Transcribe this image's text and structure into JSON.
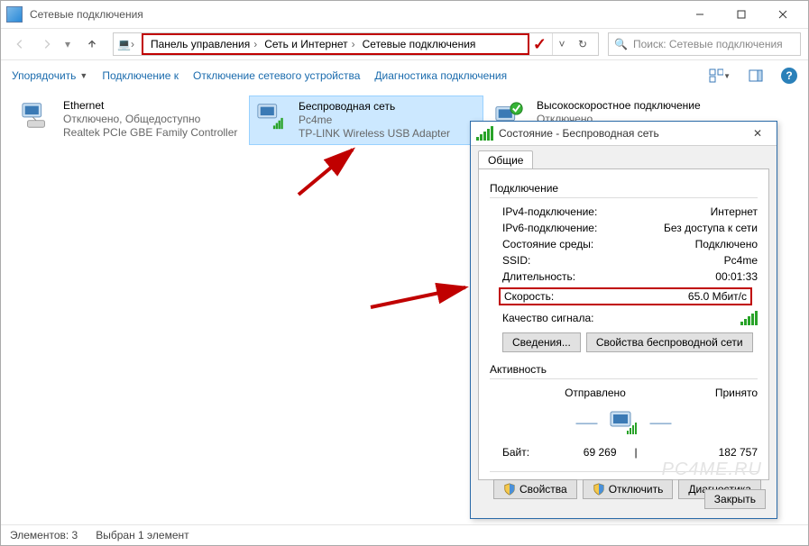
{
  "title": "Сетевые подключения",
  "breadcrumb": {
    "p1": "Панель управления",
    "p2": "Сеть и Интернет",
    "p3": "Сетевые подключения"
  },
  "search": {
    "placeholder": "Поиск: Сетевые подключения"
  },
  "toolbar": {
    "organize": "Упорядочить",
    "connect": "Подключение к",
    "disable": "Отключение сетевого устройства",
    "diagnose": "Диагностика подключения"
  },
  "connections": {
    "ethernet": {
      "name": "Ethernet",
      "status": "Отключено, Общедоступно",
      "device": "Realtek PCIe GBE Family Controller"
    },
    "wifi": {
      "name": "Беспроводная сеть",
      "ssid": "Pc4me",
      "device": "TP-LINK Wireless USB Adapter"
    },
    "dialup": {
      "name": "Высокоскоростное подключение",
      "status": "Отключено"
    }
  },
  "dialog": {
    "title": "Состояние - Беспроводная сеть",
    "tab": "Общие",
    "grp_connection": "Подключение",
    "rows": {
      "ipv4_k": "IPv4-подключение:",
      "ipv4_v": "Интернет",
      "ipv6_k": "IPv6-подключение:",
      "ipv6_v": "Без доступа к сети",
      "media_k": "Состояние среды:",
      "media_v": "Подключено",
      "ssid_k": "SSID:",
      "ssid_v": "Pc4me",
      "dur_k": "Длительность:",
      "dur_v": "00:01:33",
      "speed_k": "Скорость:",
      "speed_v": "65.0 Мбит/с",
      "qual_k": "Качество сигнала:"
    },
    "btn_details": "Сведения...",
    "btn_wprops": "Свойства беспроводной сети",
    "grp_activity": "Активность",
    "activity": {
      "sent": "Отправлено",
      "recv": "Принято",
      "bytes_label": "Байт:",
      "bytes_sent": "69 269",
      "bytes_recv": "182 757"
    },
    "btn_props": "Свойства",
    "btn_disable": "Отключить",
    "btn_diag": "Диагностика",
    "btn_close": "Закрыть"
  },
  "watermark": "PC4ME.RU",
  "status": {
    "count": "Элементов: 3",
    "selected": "Выбран 1 элемент"
  }
}
